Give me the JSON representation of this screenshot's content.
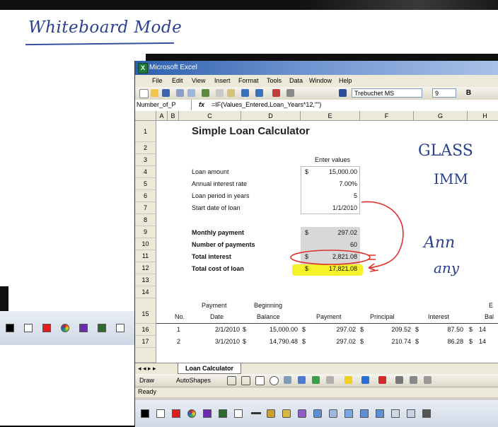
{
  "whiteboard": {
    "title": "Whiteboard Mode",
    "ink_notes": [
      "GLASS",
      "IMM",
      "Ann",
      "any"
    ]
  },
  "excel": {
    "window_title": "Microsoft Excel",
    "menu": [
      "File",
      "Edit",
      "View",
      "Insert",
      "Format",
      "Tools",
      "Data",
      "Window",
      "Help"
    ],
    "font_name": "Trebuchet MS",
    "font_size": "9",
    "name_box": "Number_of_P",
    "fx_label": "fx",
    "formula": "=IF(Values_Entered,Loan_Years*12,\"\")",
    "columns": [
      "A",
      "B",
      "C",
      "D",
      "E",
      "F",
      "G",
      "H"
    ],
    "rows": [
      "1",
      "2",
      "3",
      "4",
      "5",
      "6",
      "7",
      "8",
      "9",
      "10",
      "11",
      "12",
      "13",
      "14",
      "15",
      "16",
      "17"
    ],
    "sheet_title": "Simple Loan Calculator",
    "enter_values_header": "Enter values",
    "inputs": [
      {
        "label": "Loan amount",
        "currency": "$",
        "value": "15,000.00"
      },
      {
        "label": "Annual interest rate",
        "currency": "",
        "value": "7.00%"
      },
      {
        "label": "Loan period in years",
        "currency": "",
        "value": "5"
      },
      {
        "label": "Start date of loan",
        "currency": "",
        "value": "1/1/2010"
      }
    ],
    "outputs": [
      {
        "label": "Monthly payment",
        "currency": "$",
        "value": "297.02"
      },
      {
        "label": "Number of payments",
        "currency": "",
        "value": "60"
      },
      {
        "label": "Total interest",
        "currency": "$",
        "value": "2,821.08"
      },
      {
        "label": "Total cost of loan",
        "currency": "$",
        "value": "17,821.08"
      }
    ],
    "schedule_headers_top": {
      "payment": "Payment",
      "beginning": "Beginning",
      "e": "E"
    },
    "schedule_headers": [
      "No.",
      "Date",
      "Balance",
      "Payment",
      "Principal",
      "Interest",
      "Bal"
    ],
    "schedule_rows": [
      {
        "no": "1",
        "date": "2/1/2010",
        "balance": "15,000.00",
        "payment": "297.02",
        "principal": "209.52",
        "interest": "87.50",
        "end": "14"
      },
      {
        "no": "2",
        "date": "3/1/2010",
        "balance": "14,790.48",
        "payment": "297.02",
        "principal": "210.74",
        "interest": "86.28",
        "end": "14"
      }
    ],
    "sheet_tab": "Loan Calculator",
    "draw_label": "Draw",
    "autoshapes_label": "AutoShapes",
    "status": "Ready"
  },
  "colors": {
    "ink": "#2b3f8f",
    "highlighter": "#f5f12a",
    "red_ink": "#e0302a",
    "title_bar": "#2d5fae"
  }
}
